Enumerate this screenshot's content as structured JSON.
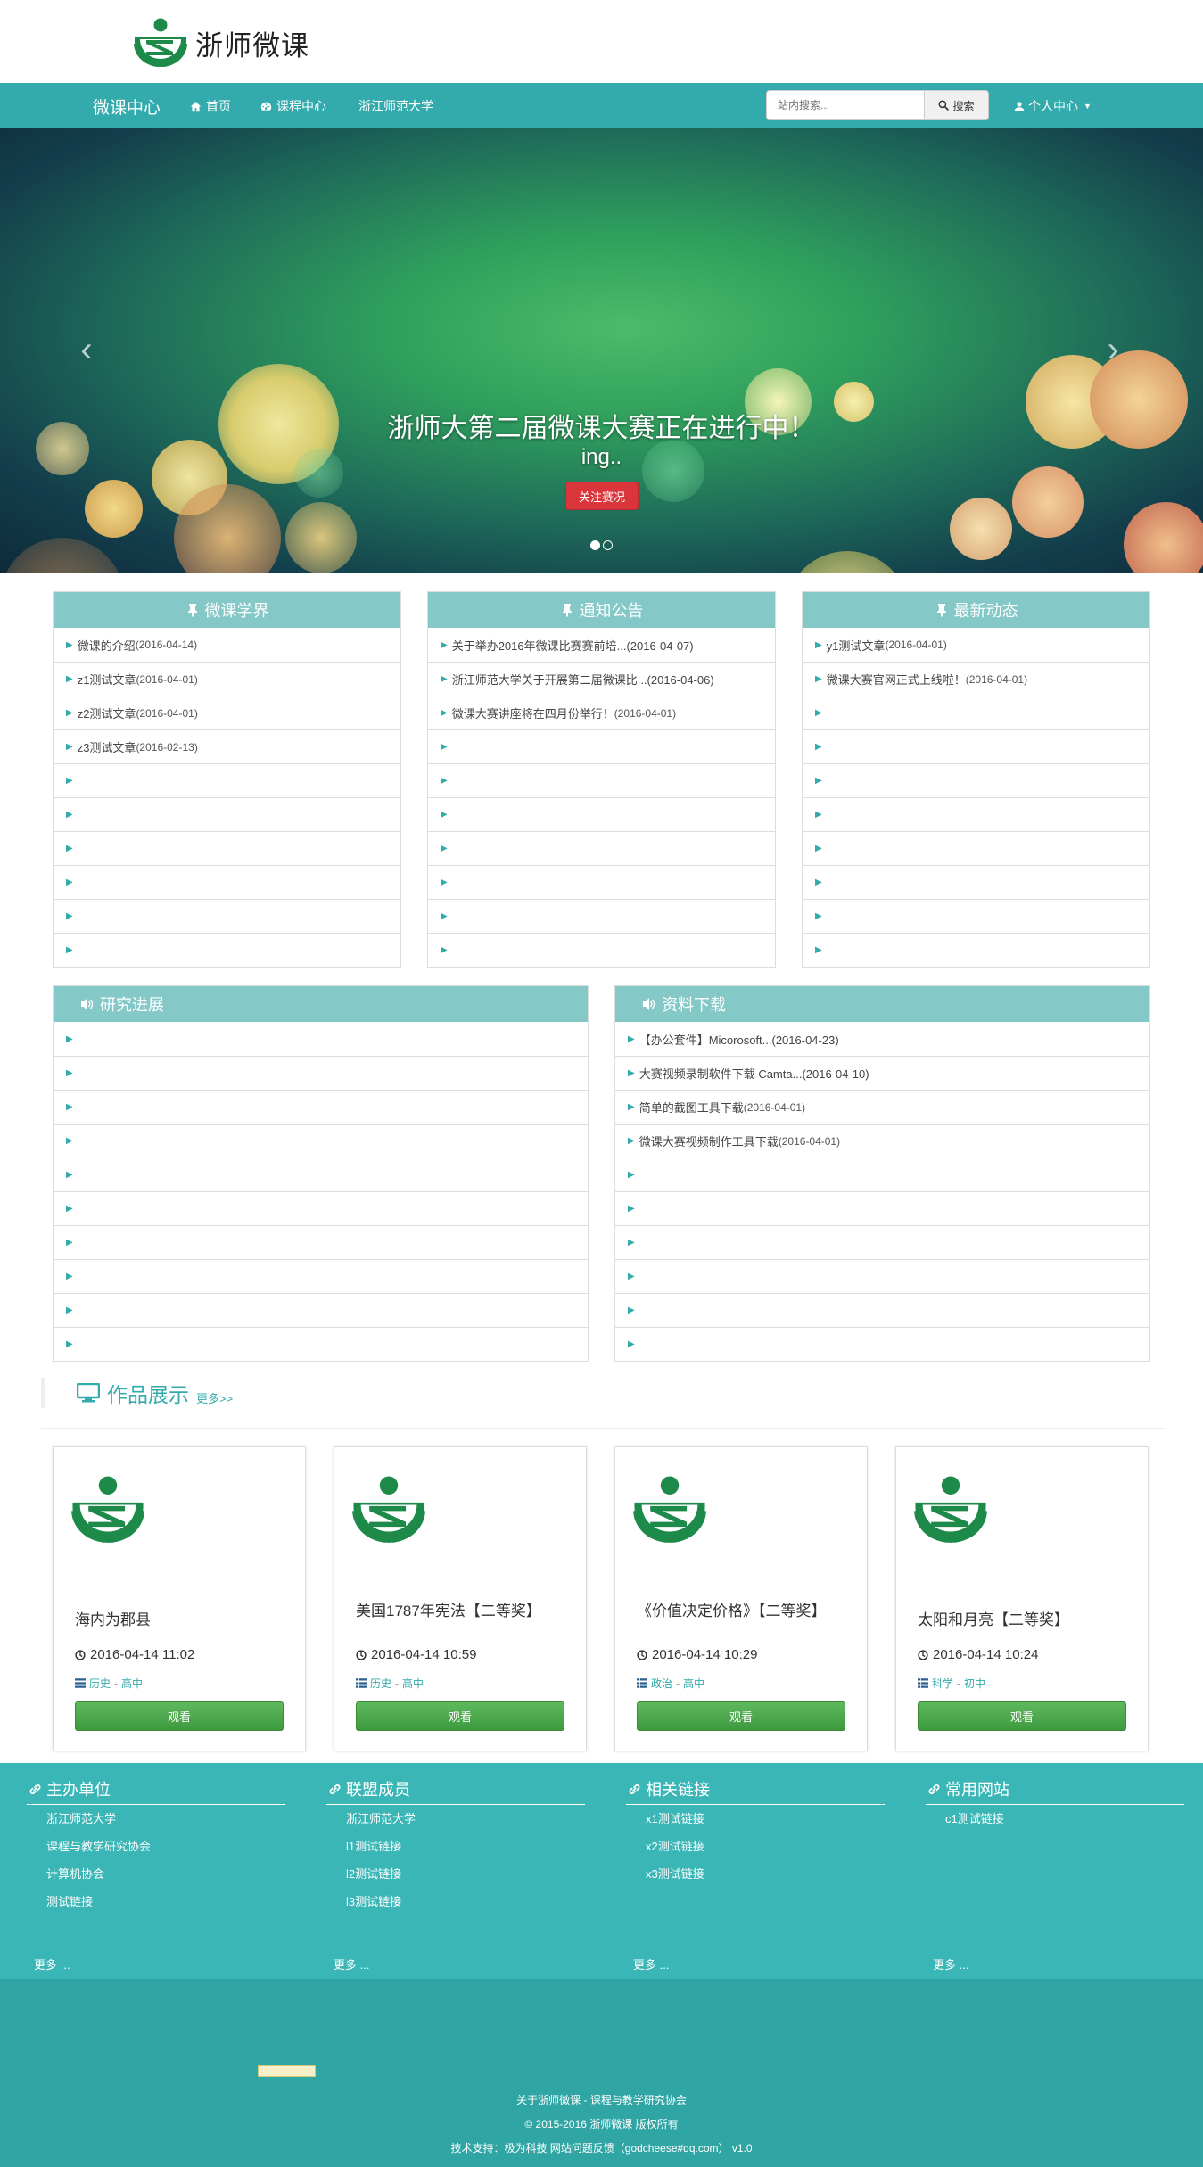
{
  "header": {
    "logo_text": "浙师微课"
  },
  "nav": {
    "brand": "微课中心",
    "items": [
      {
        "label": "首页",
        "icon": "home-icon"
      },
      {
        "label": "课程中心",
        "icon": "dashboard-icon"
      },
      {
        "label": "浙江师范大学",
        "icon": ""
      }
    ],
    "search_placeholder": "站内搜索...",
    "search_button": "搜索",
    "user_menu": "个人中心"
  },
  "carousel": {
    "title": "浙师大第二届微课大赛正在进行中！",
    "subtitle": "ing..",
    "button": "关注赛况",
    "prev": "‹",
    "next": "›"
  },
  "panels": {
    "p1": {
      "title": "微课学界",
      "rows": [
        {
          "text": "微课的介绍",
          "date": "(2016-04-14)"
        },
        {
          "text": "z1测试文章",
          "date": "(2016-04-01)"
        },
        {
          "text": "z2测试文章",
          "date": "(2016-04-01)"
        },
        {
          "text": "z3测试文章",
          "date": "(2016-02-13)"
        }
      ]
    },
    "p2": {
      "title": "通知公告",
      "rows": [
        {
          "text": "关于举办2016年微课比赛赛前培...(2016-04-07)",
          "date": ""
        },
        {
          "text": "浙江师范大学关于开展第二届微课比...(2016-04-06)",
          "date": ""
        },
        {
          "text": "微课大赛讲座将在四月份举行！",
          "date": "(2016-04-01)"
        }
      ]
    },
    "p3": {
      "title": "最新动态",
      "rows": [
        {
          "text": "y1测试文章",
          "date": "(2016-04-01)"
        },
        {
          "text": "微课大赛官网正式上线啦！",
          "date": "(2016-04-01)"
        }
      ]
    },
    "p4": {
      "title": "研究进展",
      "rows": []
    },
    "p5": {
      "title": "资料下载",
      "rows": [
        {
          "text": "【办公套件】Micorosoft...(2016-04-23)",
          "date": ""
        },
        {
          "text": "大赛视频录制软件下载 Camta...(2016-04-10)",
          "date": ""
        },
        {
          "text": "简单的截图工具下载",
          "date": "(2016-04-01)"
        },
        {
          "text": "微课大赛视频制作工具下载",
          "date": "(2016-04-01)"
        }
      ]
    }
  },
  "works": {
    "title": "作品展示",
    "more": "更多>>",
    "cards": [
      {
        "title": "海内为郡县",
        "date": "2016-04-14 11:02",
        "subject": "历史",
        "level": "高中",
        "button": "观看"
      },
      {
        "title": "美国1787年宪法【二等奖】",
        "date": "2016-04-14 10:59",
        "subject": "历史",
        "level": "高中",
        "button": "观看"
      },
      {
        "title": "《价值决定价格》【二等奖】",
        "date": "2016-04-14 10:29",
        "subject": "政治",
        "level": "高中",
        "button": "观看"
      },
      {
        "title": "太阳和月亮【二等奖】",
        "date": "2016-04-14 10:24",
        "subject": "科学",
        "level": "初中",
        "button": "观看"
      }
    ]
  },
  "footer": {
    "columns": [
      {
        "title": "主办单位",
        "links": [
          "浙江师范大学",
          "课程与教学研究协会",
          "计算机协会",
          "测试链接"
        ],
        "more": "更多 ..."
      },
      {
        "title": "联盟成员",
        "links": [
          "浙江师范大学",
          "l1测试链接",
          "l2测试链接",
          "l3测试链接"
        ],
        "more": "更多 ..."
      },
      {
        "title": "相关链接",
        "links": [
          "x1测试链接",
          "x2测试链接",
          "x3测试链接"
        ],
        "more": "更多 ..."
      },
      {
        "title": "常用网站",
        "links": [
          "c1测试链接"
        ],
        "more": "更多 ..."
      }
    ],
    "line1": "关于浙师微课 - 课程与教学研究协会",
    "line2": "© 2015-2016 浙师微课 版权所有",
    "line3": "技术支持：极为科技 网站问题反馈（godcheese#qq.com） v1.0"
  },
  "colors": {
    "accent": "#33aaab",
    "panel_head": "#85c8c8",
    "footer": "#3ab6b7",
    "footer_bottom": "#2fa5a4",
    "red_button": "#d9353a",
    "green_button": "#4cae4c"
  }
}
